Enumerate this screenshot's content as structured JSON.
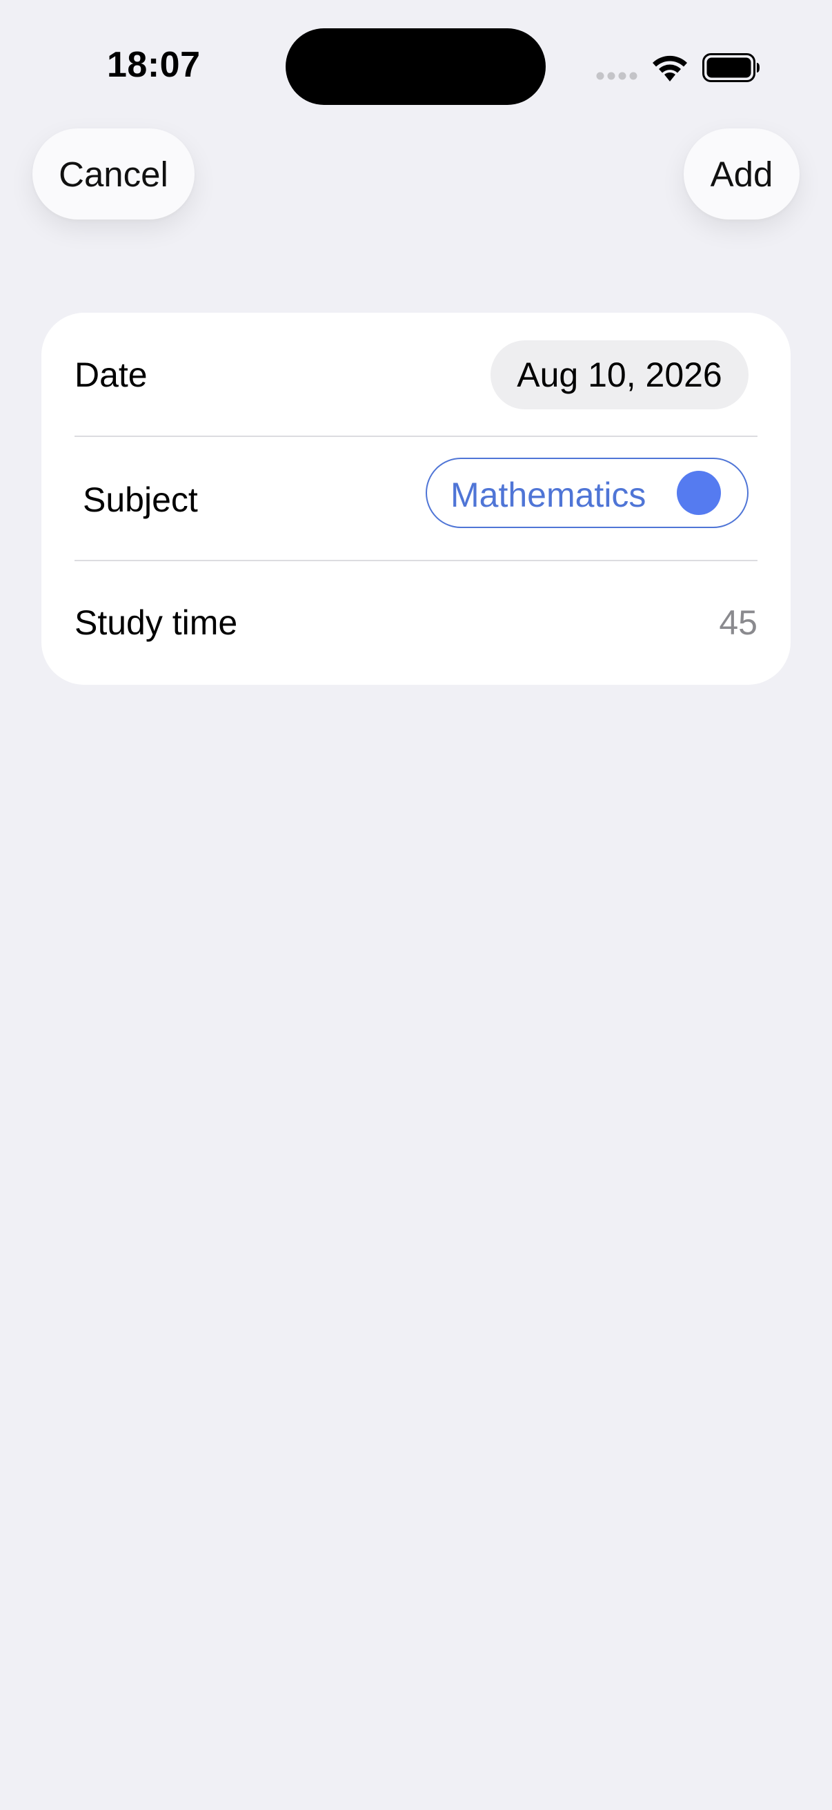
{
  "status_bar": {
    "time": "18:07"
  },
  "nav": {
    "cancel_label": "Cancel",
    "add_label": "Add"
  },
  "form": {
    "date": {
      "label": "Date",
      "value": "Aug 10, 2026"
    },
    "subject": {
      "label": "Subject",
      "value": "Mathematics",
      "color": "#557BF0"
    },
    "study_time": {
      "label": "Study time",
      "value": "45"
    }
  },
  "colors": {
    "background": "#F0F0F5",
    "accent": "#4F75D6"
  }
}
